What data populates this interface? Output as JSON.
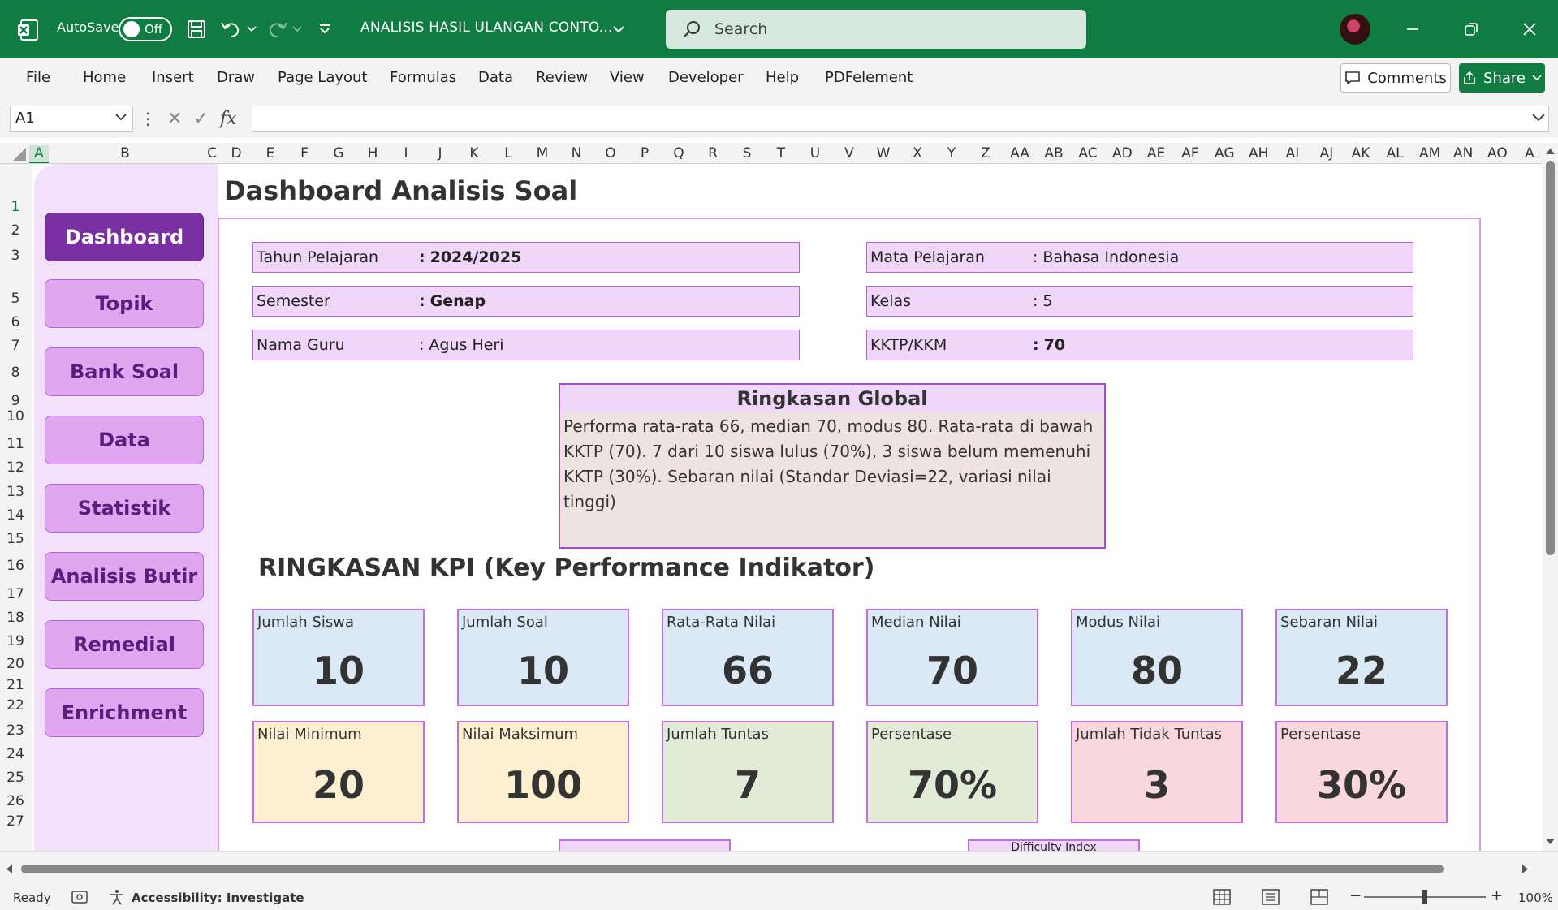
{
  "titlebar": {
    "autosave_label": "AutoSave",
    "autosave_state": "Off",
    "doc_title": "ANALISIS HASIL ULANGAN CONTO...",
    "search_placeholder": "Search"
  },
  "ribbon": {
    "tabs": [
      "File",
      "Home",
      "Insert",
      "Draw",
      "Page Layout",
      "Formulas",
      "Data",
      "Review",
      "View",
      "Developer",
      "Help",
      "PDFelement"
    ],
    "comments_label": "Comments",
    "share_label": "Share"
  },
  "formula_bar": {
    "name_box": "A1",
    "fx": "fx",
    "formula": ""
  },
  "columns": [
    "A",
    "B",
    "C",
    "D",
    "E",
    "F",
    "G",
    "H",
    "I",
    "J",
    "K",
    "L",
    "M",
    "N",
    "O",
    "P",
    "Q",
    "R",
    "S",
    "T",
    "U",
    "V",
    "W",
    "X",
    "Y",
    "Z",
    "AA",
    "AB",
    "AC",
    "AD",
    "AE",
    "AF",
    "AG",
    "AH",
    "AI",
    "AJ",
    "AK",
    "AL",
    "AM",
    "AN",
    "AO",
    "A"
  ],
  "rows": [
    "1",
    "2",
    "3",
    "5",
    "6",
    "7",
    "8",
    "9",
    "10",
    "11",
    "12",
    "13",
    "14",
    "15",
    "16",
    "17",
    "18",
    "19",
    "20",
    "21",
    "22",
    "23",
    "24",
    "25",
    "26",
    "27"
  ],
  "sidebar": {
    "items": [
      "Dashboard",
      "Topik",
      "Bank Soal",
      "Data",
      "Statistik",
      "Analisis Butir",
      "Remedial",
      "Enrichment"
    ],
    "active": "Dashboard"
  },
  "dashboard": {
    "title": "Dashboard Analisis Soal",
    "info_left": [
      {
        "label": "Tahun Pelajaran",
        "value": "2024/2025"
      },
      {
        "label": "Semester",
        "value": "Genap"
      },
      {
        "label": "Nama Guru",
        "value": "Agus Heri"
      }
    ],
    "info_right": [
      {
        "label": "Mata Pelajaran",
        "value": "Bahasa Indonesia"
      },
      {
        "label": "Kelas",
        "value": "5"
      },
      {
        "label": "KKTP/KKM",
        "value": "70"
      }
    ],
    "separator": ":",
    "ringkasan": {
      "title": "Ringkasan Global",
      "text": "Performa rata-rata 66, median 70, modus 80. Rata-rata di bawah KKTP (70). 7 dari 10 siswa lulus (70%), 3 siswa belum memenuhi KKTP (30%). Sebaran nilai (Standar Deviasi=22, variasi nilai tinggi)"
    },
    "kpi_title": "RINGKASAN KPI (Key Performance Indikator)",
    "kpi_row1": [
      {
        "label": "Jumlah Siswa",
        "value": "10"
      },
      {
        "label": "Jumlah Soal",
        "value": "10"
      },
      {
        "label": "Rata-Rata Nilai",
        "value": "66"
      },
      {
        "label": "Median Nilai",
        "value": "70"
      },
      {
        "label": "Modus Nilai",
        "value": "80"
      },
      {
        "label": "Sebaran Nilai",
        "value": "22"
      }
    ],
    "kpi_row2": [
      {
        "label": "Nilai Minimum",
        "value": "20"
      },
      {
        "label": "Nilai Maksimum",
        "value": "100"
      },
      {
        "label": "Jumlah Tuntas",
        "value": "7"
      },
      {
        "label": "Persentase",
        "value": "70%"
      },
      {
        "label": "Jumlah Tidak Tuntas",
        "value": "3"
      },
      {
        "label": "Persentase",
        "value": "30%"
      }
    ],
    "peek_right": "Difficulty Index"
  },
  "status": {
    "ready": "Ready",
    "accessibility": "Accessibility: Investigate",
    "zoom": "100%"
  }
}
